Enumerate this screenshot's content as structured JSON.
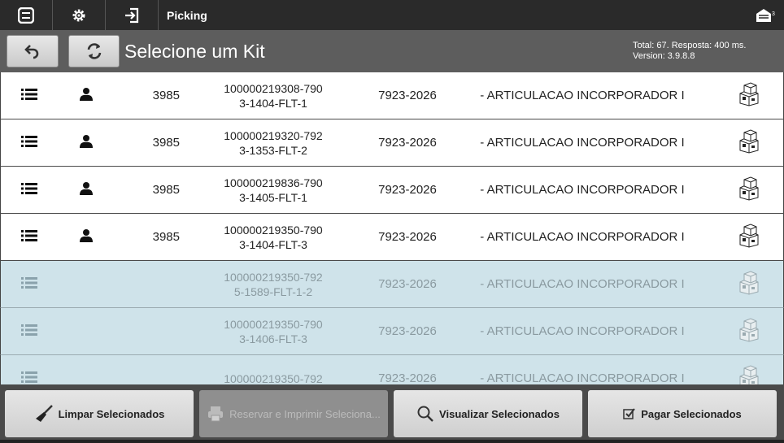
{
  "topbar": {
    "title": "Picking",
    "icons": [
      "list-icon",
      "gear-icon",
      "login-icon"
    ],
    "notification_count": "3"
  },
  "header": {
    "title": "Selecione um Kit",
    "info_line1": "Total: 67. Resposta: 400 ms.",
    "info_line2": "Version: 3.9.8.8"
  },
  "rows": [
    {
      "num": "3985",
      "code1": "100000219308-790",
      "code2": "3-1404-FLT-1",
      "date": "7923-2026",
      "desc": "- ARTICULACAO INCORPORADOR I",
      "selected": false
    },
    {
      "num": "3985",
      "code1": "100000219320-792",
      "code2": "3-1353-FLT-2",
      "date": "7923-2026",
      "desc": "- ARTICULACAO INCORPORADOR I",
      "selected": false
    },
    {
      "num": "3985",
      "code1": "100000219836-790",
      "code2": "3-1405-FLT-1",
      "date": "7923-2026",
      "desc": "- ARTICULACAO INCORPORADOR I",
      "selected": false
    },
    {
      "num": "3985",
      "code1": "100000219350-790",
      "code2": "3-1404-FLT-3",
      "date": "7923-2026",
      "desc": "- ARTICULACAO INCORPORADOR I",
      "selected": false
    },
    {
      "num": "",
      "code1": "100000219350-792",
      "code2": "5-1589-FLT-1-2",
      "date": "7923-2026",
      "desc": "- ARTICULACAO INCORPORADOR I",
      "selected": true
    },
    {
      "num": "",
      "code1": "100000219350-790",
      "code2": "3-1406-FLT-3",
      "date": "7923-2026",
      "desc": "- ARTICULACAO INCORPORADOR I",
      "selected": true
    },
    {
      "num": "",
      "code1": "100000219350-792",
      "code2": "",
      "date": "7923-2026",
      "desc": "- ARTICULACAO INCORPORADOR I",
      "selected": true
    }
  ],
  "footer": {
    "clear_label": "Limpar Selecionados",
    "reserve_label": "Reservar e Imprimir Seleciona...",
    "view_label": "Visualizar Selecionados",
    "pay_label": "Pagar Selecionados"
  }
}
